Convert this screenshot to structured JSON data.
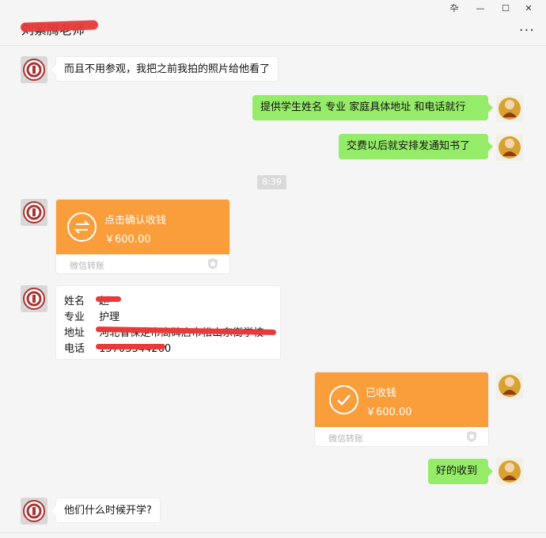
{
  "window": {
    "title": "刘紫腾老师",
    "controls": {
      "pin": "卆",
      "minimize": "—",
      "maximize": "☐",
      "close": "✕"
    },
    "more": "···"
  },
  "messages": {
    "m1": "而且不用参观，我把之前我拍的照片给他看了",
    "m2": "提供学生姓名 专业 家庭具体地址 和电话就行",
    "m3": "交费以后就安排发通知书了",
    "time": "8:39",
    "transfer1": {
      "title": "点击确认收钱",
      "amount": "￥600.00",
      "footer": "微信转账"
    },
    "info": {
      "name_key": "姓名",
      "name_val": "赵",
      "major_key": "专业",
      "major_val": "护理",
      "addr_key": "地址",
      "addr_val": "河北省保定市高碑店市松山东街学校",
      "phone_key": "电话",
      "phone_val": "15703344260"
    },
    "transfer2": {
      "title": "已收钱",
      "amount": "￥600.00",
      "footer": "微信转账"
    },
    "m4": "好的收到",
    "m5": "他们什么时候开学?"
  },
  "colors": {
    "green": "#95ec69",
    "orange": "#fa9d3b",
    "background": "#f5f5f5",
    "redaction": "#e83a3a"
  },
  "icons": [
    "transfer-arrows-icon",
    "checkmark-icon",
    "shield-icon",
    "school-logo-avatar",
    "monk-avatar"
  ]
}
